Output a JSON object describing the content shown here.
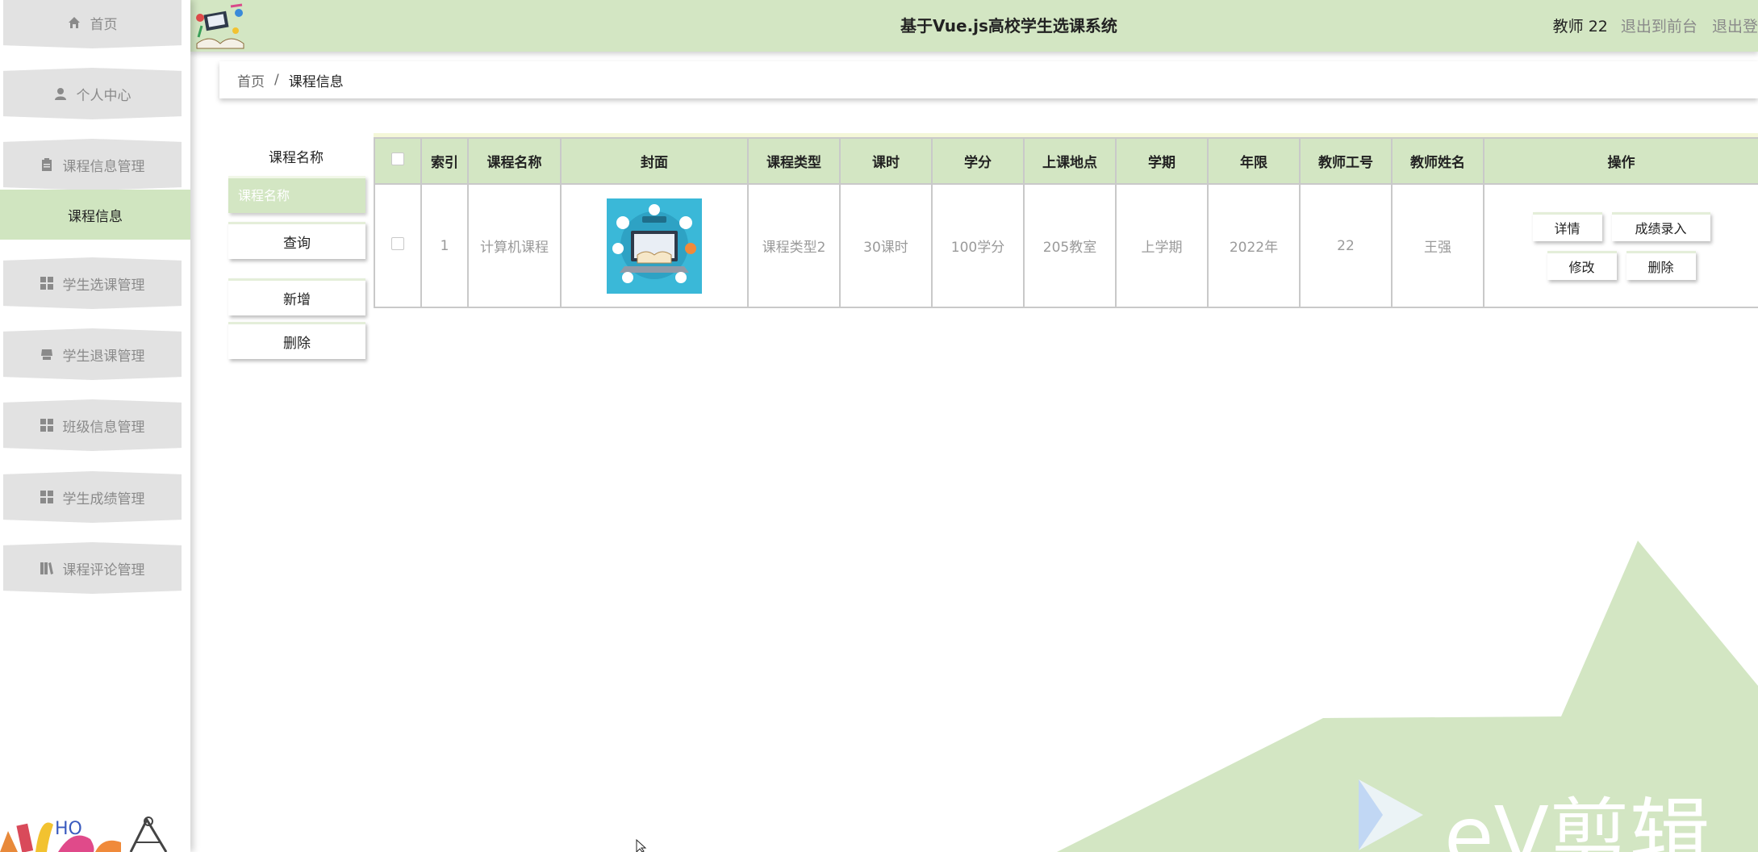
{
  "colors": {
    "header_bg": "#d3e6c3",
    "accent": "#d0e5c0",
    "menu_bg": "#e2e2e2",
    "border": "#c9c9c9"
  },
  "sidebar": {
    "items": [
      {
        "label": "首页",
        "icon": "home-icon"
      },
      {
        "label": "个人中心",
        "icon": "user-icon"
      },
      {
        "label": "课程信息管理",
        "icon": "clipboard-icon"
      },
      {
        "label": "课程信息",
        "icon": "",
        "active": true
      },
      {
        "label": "学生选课管理",
        "icon": "grid-icon"
      },
      {
        "label": "学生退课管理",
        "icon": "tray-icon"
      },
      {
        "label": "班级信息管理",
        "icon": "grid-icon"
      },
      {
        "label": "学生成绩管理",
        "icon": "grid-icon"
      },
      {
        "label": "课程评论管理",
        "icon": "books-icon"
      }
    ]
  },
  "header": {
    "title": "基于Vue.js高校学生选课系统",
    "user": "教师 22",
    "front_link": "退出到前台",
    "logout_link": "退出登"
  },
  "breadcrumb": {
    "home": "首页",
    "separator": "/",
    "current": "课程信息"
  },
  "search": {
    "label": "课程名称",
    "placeholder": "课程名称",
    "query_button": "查询",
    "add_button": "新增",
    "delete_button": "删除"
  },
  "table": {
    "headers": [
      "索引",
      "课程名称",
      "封面",
      "课程类型",
      "课时",
      "学分",
      "上课地点",
      "学期",
      "年限",
      "教师工号",
      "教师姓名",
      "操作"
    ],
    "rows": [
      {
        "index": "1",
        "name": "计算机课程",
        "type": "课程类型2",
        "hours": "30课时",
        "credits": "100学分",
        "location": "205教室",
        "term": "上学期",
        "year": "2022年",
        "teacher_id": "22",
        "teacher_name": "王强",
        "ops": {
          "detail": "详情",
          "score": "成绩录入",
          "edit": "修改",
          "delete": "删除"
        }
      }
    ]
  },
  "watermark": {
    "text": "eV剪辑"
  }
}
